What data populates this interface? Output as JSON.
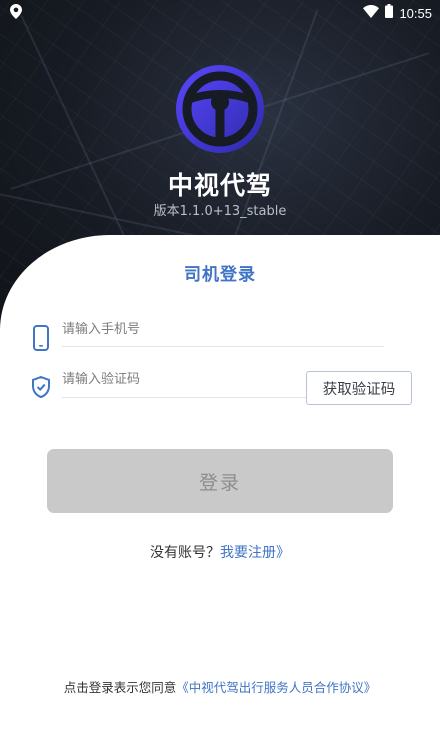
{
  "status_bar": {
    "time": "10:55"
  },
  "app": {
    "name": "中视代驾",
    "version": "版本1.1.0+13_stable"
  },
  "login": {
    "title": "司机登录",
    "phone_placeholder": "请输入手机号",
    "code_placeholder": "请输入验证码",
    "get_code_label": "获取验证码",
    "submit_label": "登录",
    "no_account_text": "没有账号？",
    "register_link": "我要注册》"
  },
  "footer": {
    "agreement_prefix": "点击登录表示您同意",
    "agreement_link": "《中视代驾出行服务人员合作协议》"
  },
  "colors": {
    "accent": "#3f74c6",
    "logo_gradient_start": "#4a3df0",
    "logo_gradient_end": "#2a2a9a",
    "button_disabled": "#c9c9c9"
  },
  "icons": {
    "location": "location-pin-icon",
    "wifi": "wifi-icon",
    "battery": "battery-icon",
    "phone": "phone-icon",
    "shield": "shield-check-icon"
  }
}
